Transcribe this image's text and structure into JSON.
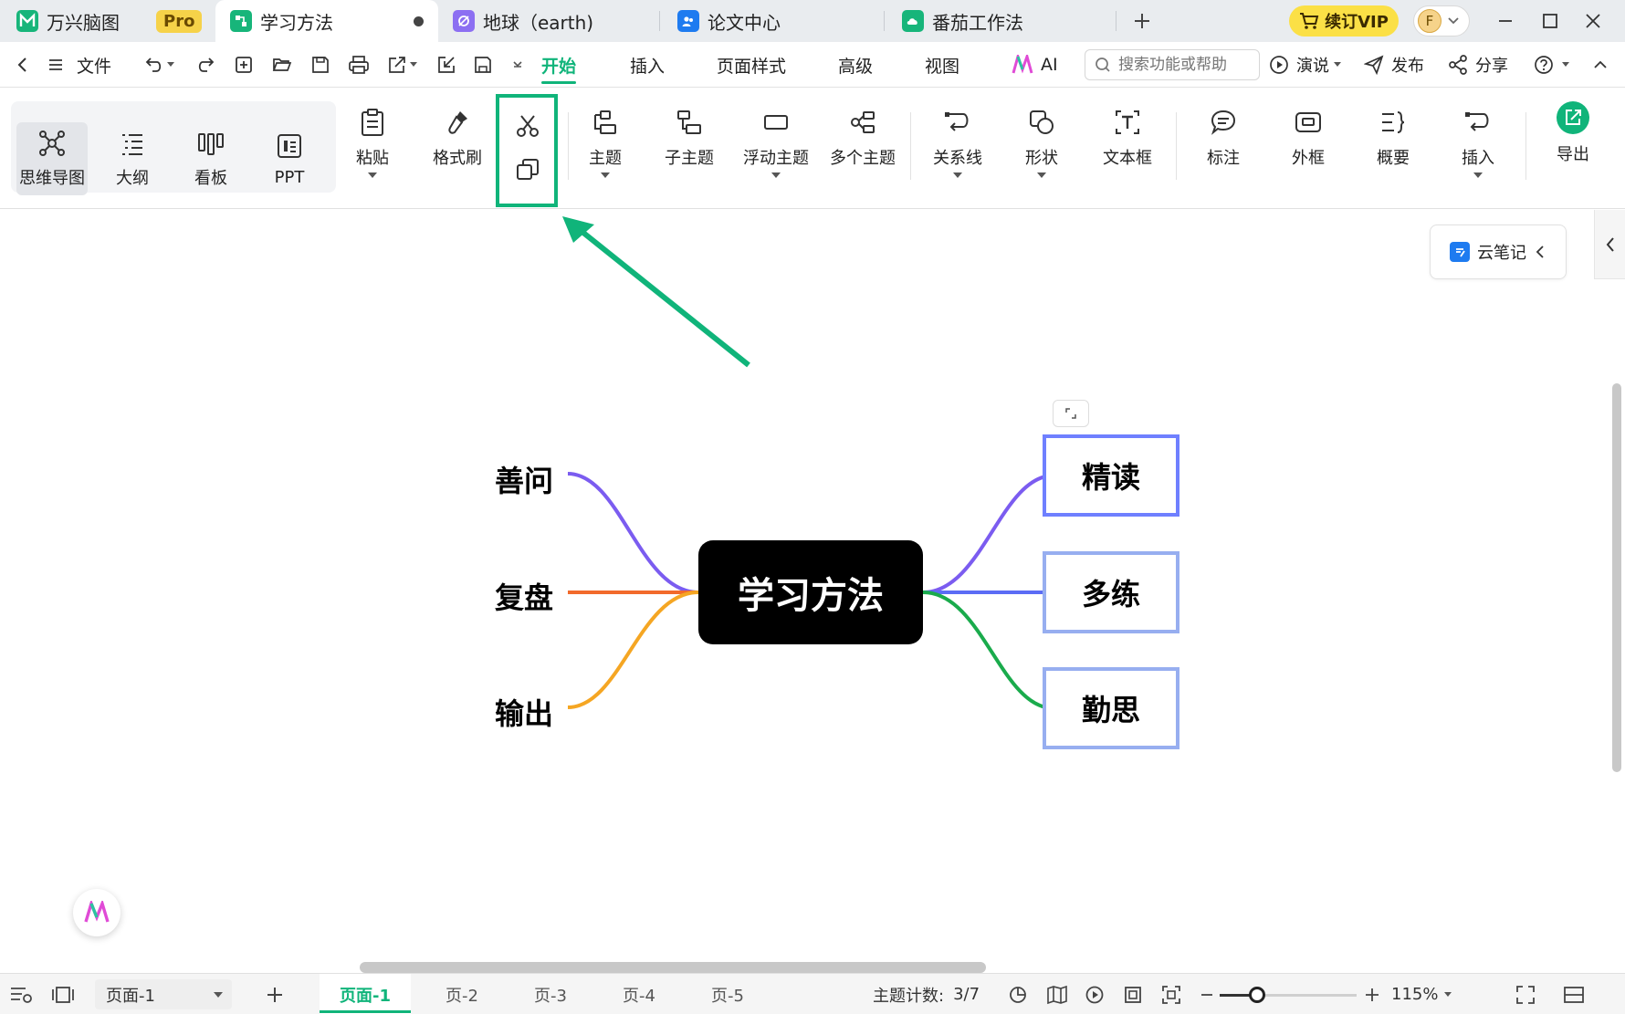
{
  "tabs": {
    "app_name": "万兴脑图",
    "pro_badge": "Pro",
    "doc1": "学习方法",
    "doc2": "地球（earth)",
    "doc3": "论文中心",
    "doc4": "番茄工作法",
    "vip_label": "续订VIP",
    "avatar_letter": "F"
  },
  "menu": {
    "file": "文件",
    "start": "开始",
    "insert": "插入",
    "page_style": "页面样式",
    "advanced": "高级",
    "view": "视图",
    "ai": "AI",
    "search_placeholder": "搜索功能或帮助",
    "present": "演说",
    "publish": "发布",
    "share": "分享"
  },
  "toolbar": {
    "mindmap": "思维导图",
    "outline": "大纲",
    "kanban": "看板",
    "ppt": "PPT",
    "paste": "粘贴",
    "format_painter": "格式刷",
    "topic": "主题",
    "subtopic": "子主题",
    "floating_topic": "浮动主题",
    "multi_topic": "多个主题",
    "relationship": "关系线",
    "shape": "形状",
    "textbox": "文本框",
    "callout": "标注",
    "boundary": "外框",
    "summary": "概要",
    "insert": "插入",
    "export": "导出"
  },
  "mindmap": {
    "central": "学习方法",
    "left": [
      "善问",
      "复盘",
      "输出"
    ],
    "right": [
      "精读",
      "多练",
      "勤思"
    ],
    "colors": {
      "left_top": "#7b5cf0",
      "left_mid": "#f26a2b",
      "left_bottom": "#f5a623",
      "right_top": "#7b5cf0",
      "right_mid": "#5b6cf5",
      "right_bottom": "#1aab4c",
      "accent": "#10b47a"
    }
  },
  "side": {
    "cloud_note": "云笔记"
  },
  "status": {
    "page_select": "页面-1",
    "pages": [
      "页面-1",
      "页-2",
      "页-3",
      "页-4",
      "页-5"
    ],
    "topic_count_label": "主题计数:",
    "topic_count_value": "3/7",
    "zoom": "115%",
    "zoom_level_fraction": 0.27
  }
}
